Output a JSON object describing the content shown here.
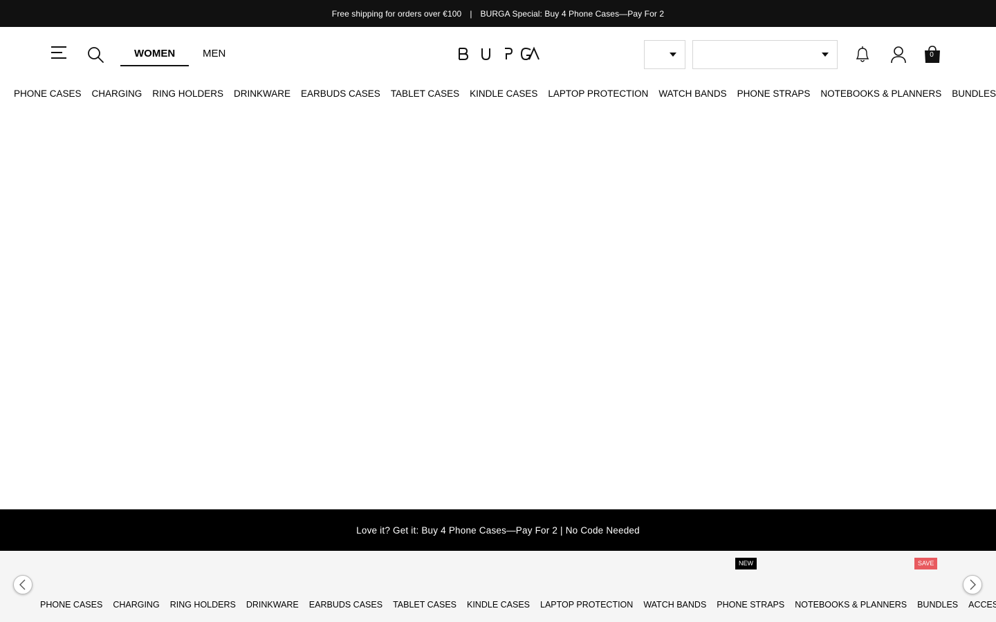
{
  "announcement": {
    "left": "Free shipping for orders over €100",
    "separator": "|",
    "right": "BURGA Special: Buy 4 Phone Cases—Pay For 2"
  },
  "header": {
    "menu_icon": "hamburger-menu-icon",
    "search_icon": "search-icon",
    "tabs": [
      {
        "label": "WOMEN",
        "active": true
      },
      {
        "label": "MEN",
        "active": false
      }
    ],
    "logo": "BURGA",
    "bell_icon": "bell-icon",
    "user_icon": "user-icon",
    "cart_icon": "shopping-bag-icon",
    "cart_count": "0"
  },
  "categories": [
    "PHONE CASES",
    "CHARGING",
    "RING HOLDERS",
    "DRINKWARE",
    "EARBUDS CASES",
    "TABLET CASES",
    "KINDLE CASES",
    "LAPTOP PROTECTION",
    "WATCH BANDS",
    "PHONE STRAPS",
    "NOTEBOOKS & PLANNERS",
    "BUNDLES"
  ],
  "promo_banner": "Love it? Get it: Buy 4 Phone Cases—Pay For 2 | No Code Needed",
  "bottom_categories": [
    "PHONE CASES",
    "CHARGING",
    "RING HOLDERS",
    "DRINKWARE",
    "EARBUDS CASES",
    "TABLET CASES",
    "KINDLE CASES",
    "LAPTOP PROTECTION",
    "WATCH BANDS",
    "PHONE STRAPS",
    "NOTEBOOKS & PLANNERS",
    "BUNDLES",
    "ACCES"
  ],
  "badges": {
    "new": "NEW",
    "save": "SAVE"
  },
  "colors": {
    "announce_bg": "#111111",
    "promo_bg": "#000000",
    "bottom_bar_bg": "#f5f5f5",
    "save_badge": "#e85a5f"
  }
}
